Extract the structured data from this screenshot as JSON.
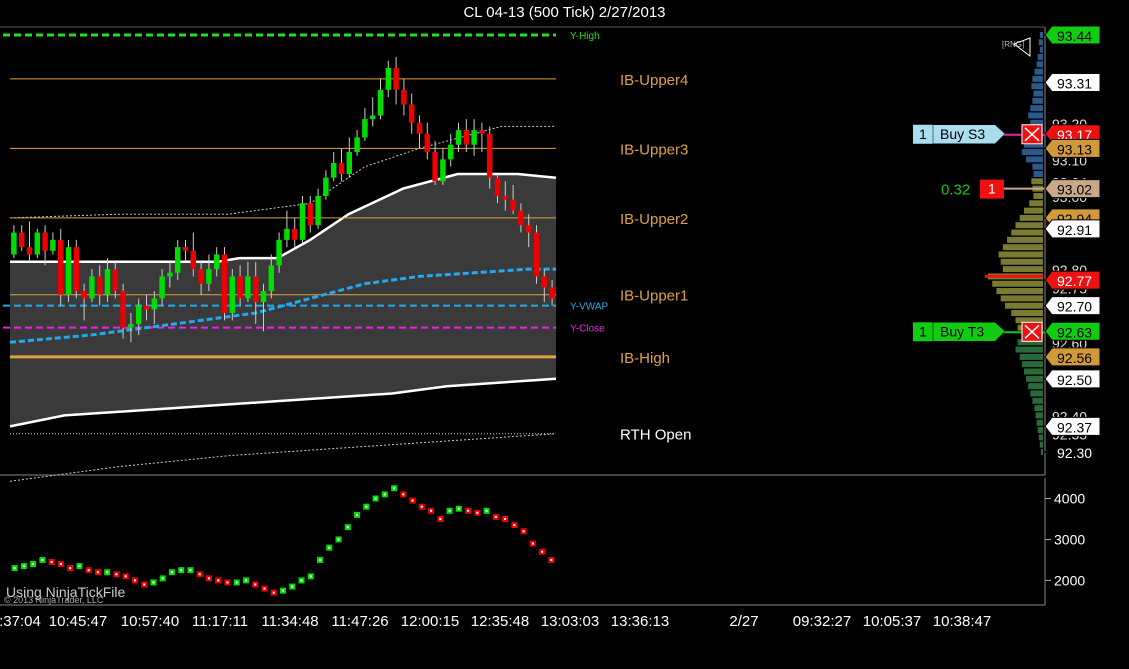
{
  "window": {
    "title": "CL 04-13 (500 Tick)  2/27/2013"
  },
  "colors": {
    "up": "#00dd00",
    "down": "#ee0000",
    "vwap": "#22aaee",
    "y_high": "#22dd22",
    "y_close": "#ee22ee",
    "ib": "#e0a040",
    "band_fill": "#3a3a3a",
    "volume_bar": "#3a7a2a"
  },
  "chart_data": [
    {
      "type": "candlestick",
      "title": "CL 04-13 (500 Tick)  2/27/2013",
      "ylim": [
        92.22,
        93.47
      ],
      "grid": false,
      "price_axis_labels": [
        "93.44",
        "93.31",
        "93.17",
        "93.13",
        "93.02",
        "92.94",
        "92.91",
        "92.77",
        "92.70",
        "92.63",
        "92.56",
        "92.50",
        "92.37",
        "92.30"
      ],
      "faint_axis_labels": [
        "93.20",
        "93.10",
        "93.04",
        "93.00",
        "92.80",
        "92.75",
        "92.60",
        "92.40",
        "92.35"
      ],
      "reference_lines": [
        {
          "name": "Y-High",
          "value": 93.44,
          "style": "dashed",
          "color": "#22dd22"
        },
        {
          "name": "Y-VWAP",
          "value": 92.7,
          "style": "dashed",
          "color": "#22aaee"
        },
        {
          "name": "Y-Close",
          "value": 92.64,
          "style": "dashed",
          "color": "#ee22ee"
        },
        {
          "name": "IB-Upper4",
          "value": 93.32,
          "style": "solid",
          "color": "#e0a040"
        },
        {
          "name": "IB-Upper3",
          "value": 93.13,
          "style": "solid",
          "color": "#e0a040"
        },
        {
          "name": "IB-Upper2",
          "value": 92.94,
          "style": "solid",
          "color": "#e0a040"
        },
        {
          "name": "IB-Upper1",
          "value": 92.73,
          "style": "solid",
          "color": "#e0a040"
        },
        {
          "name": "IB-High",
          "value": 92.56,
          "style": "solid-thick",
          "color": "#e0a040"
        },
        {
          "name": "RTH Open",
          "value": 92.35,
          "style": "dotted",
          "color": "#cccccc"
        }
      ],
      "side_labels": [
        "IB-Upper4",
        "IB-Upper3",
        "IB-Upper2",
        "IB-Upper1",
        "IB-High",
        "RTH Open"
      ],
      "candles": [
        [
          92.84,
          92.9,
          92.83,
          92.92
        ],
        [
          92.9,
          92.86,
          92.85,
          92.92
        ],
        [
          92.86,
          92.84,
          92.82,
          92.93
        ],
        [
          92.84,
          92.9,
          92.83,
          92.91
        ],
        [
          92.9,
          92.85,
          92.81,
          92.92
        ],
        [
          92.85,
          92.88,
          92.84,
          92.9
        ],
        [
          92.88,
          92.73,
          92.7,
          92.91
        ],
        [
          92.73,
          92.86,
          92.71,
          92.88
        ],
        [
          92.86,
          92.74,
          92.72,
          92.88
        ],
        [
          92.74,
          92.72,
          92.66,
          92.76
        ],
        [
          92.72,
          92.78,
          92.71,
          92.8
        ],
        [
          92.78,
          92.73,
          92.7,
          92.81
        ],
        [
          92.73,
          92.8,
          92.71,
          92.83
        ],
        [
          92.8,
          92.74,
          92.72,
          92.82
        ],
        [
          92.74,
          92.64,
          92.61,
          92.76
        ],
        [
          92.64,
          92.65,
          92.6,
          92.68
        ],
        [
          92.65,
          92.7,
          92.62,
          92.72
        ],
        [
          92.7,
          92.69,
          92.66,
          92.73
        ],
        [
          92.69,
          92.72,
          92.65,
          92.74
        ],
        [
          92.72,
          92.78,
          92.7,
          92.8
        ],
        [
          92.78,
          92.79,
          92.75,
          92.82
        ],
        [
          92.79,
          92.86,
          92.77,
          92.88
        ],
        [
          92.86,
          92.85,
          92.82,
          92.88
        ],
        [
          92.85,
          92.8,
          92.78,
          92.9
        ],
        [
          92.8,
          92.76,
          92.73,
          92.82
        ],
        [
          92.76,
          92.8,
          92.74,
          92.84
        ],
        [
          92.8,
          92.84,
          92.78,
          92.86
        ],
        [
          92.84,
          92.68,
          92.66,
          92.86
        ],
        [
          92.68,
          92.78,
          92.66,
          92.8
        ],
        [
          92.78,
          92.72,
          92.7,
          92.81
        ],
        [
          92.72,
          92.78,
          92.71,
          92.82
        ],
        [
          92.78,
          92.71,
          92.65,
          92.82
        ],
        [
          92.71,
          92.74,
          92.63,
          92.76
        ],
        [
          92.74,
          92.81,
          92.72,
          92.84
        ],
        [
          92.81,
          92.88,
          92.79,
          92.9
        ],
        [
          92.88,
          92.91,
          92.86,
          92.96
        ],
        [
          92.91,
          92.88,
          92.86,
          92.94
        ],
        [
          92.88,
          92.98,
          92.87,
          93.0
        ],
        [
          92.98,
          92.92,
          92.9,
          93.0
        ],
        [
          92.92,
          93.0,
          92.91,
          93.02
        ],
        [
          93.0,
          93.05,
          92.99,
          93.07
        ],
        [
          93.05,
          93.09,
          93.04,
          93.12
        ],
        [
          93.09,
          93.06,
          93.04,
          93.13
        ],
        [
          93.06,
          93.12,
          93.05,
          93.16
        ],
        [
          93.12,
          93.16,
          93.11,
          93.18
        ],
        [
          93.16,
          93.21,
          93.15,
          93.24
        ],
        [
          93.21,
          93.22,
          93.19,
          93.27
        ],
        [
          93.22,
          93.29,
          93.21,
          93.32
        ],
        [
          93.29,
          93.35,
          93.27,
          93.37
        ],
        [
          93.35,
          93.29,
          93.25,
          93.38
        ],
        [
          93.29,
          93.25,
          93.22,
          93.32
        ],
        [
          93.25,
          93.2,
          93.17,
          93.28
        ],
        [
          93.2,
          93.17,
          93.13,
          93.22
        ],
        [
          93.17,
          93.12,
          93.1,
          93.2
        ],
        [
          93.12,
          93.04,
          93.03,
          93.15
        ],
        [
          93.04,
          93.1,
          93.03,
          93.13
        ],
        [
          93.1,
          93.14,
          93.08,
          93.17
        ],
        [
          93.14,
          93.18,
          93.12,
          93.2
        ],
        [
          93.18,
          93.14,
          93.12,
          93.21
        ],
        [
          93.14,
          93.18,
          93.11,
          93.21
        ],
        [
          93.18,
          93.17,
          93.12,
          93.2
        ],
        [
          93.17,
          93.05,
          93.02,
          93.19
        ],
        [
          93.05,
          93.0,
          92.98,
          93.06
        ],
        [
          93.0,
          92.99,
          92.96,
          93.04
        ],
        [
          92.99,
          92.96,
          92.95,
          93.03
        ],
        [
          92.96,
          92.92,
          92.9,
          92.98
        ],
        [
          92.92,
          92.9,
          92.86,
          92.95
        ],
        [
          92.9,
          92.78,
          92.76,
          92.92
        ],
        [
          92.78,
          92.75,
          92.71,
          92.8
        ],
        [
          92.75,
          92.72,
          92.7,
          92.77
        ]
      ],
      "band_upper": [
        [
          0,
          92.82
        ],
        [
          0.38,
          92.82
        ],
        [
          0.42,
          92.83
        ],
        [
          0.49,
          92.83
        ],
        [
          0.55,
          92.88
        ],
        [
          0.62,
          92.95
        ],
        [
          0.72,
          93.02
        ],
        [
          0.82,
          93.06
        ],
        [
          0.88,
          93.06
        ],
        [
          0.93,
          93.06
        ],
        [
          1.0,
          93.05
        ]
      ],
      "band_lower": [
        [
          0,
          92.37
        ],
        [
          0.1,
          92.4
        ],
        [
          0.2,
          92.41
        ],
        [
          0.3,
          92.42
        ],
        [
          0.4,
          92.43
        ],
        [
          0.5,
          92.44
        ],
        [
          0.6,
          92.45
        ],
        [
          0.7,
          92.46
        ],
        [
          0.8,
          92.48
        ],
        [
          0.9,
          92.49
        ],
        [
          1.0,
          92.5
        ]
      ],
      "vwap_curve": [
        [
          0,
          92.6
        ],
        [
          0.15,
          92.62
        ],
        [
          0.3,
          92.65
        ],
        [
          0.45,
          92.68
        ],
        [
          0.55,
          92.72
        ],
        [
          0.65,
          92.76
        ],
        [
          0.75,
          92.78
        ],
        [
          0.85,
          92.79
        ],
        [
          0.95,
          92.8
        ],
        [
          1.0,
          92.8
        ]
      ],
      "outer_upper": [
        [
          0,
          92.94
        ],
        [
          0.2,
          92.95
        ],
        [
          0.4,
          92.95
        ],
        [
          0.55,
          92.98
        ],
        [
          0.65,
          93.08
        ],
        [
          0.75,
          93.13
        ],
        [
          0.9,
          93.19
        ],
        [
          1.0,
          93.19
        ]
      ],
      "outer_lower": [
        [
          0,
          92.22
        ],
        [
          0.2,
          92.26
        ],
        [
          0.4,
          92.29
        ],
        [
          0.6,
          92.31
        ],
        [
          0.8,
          92.33
        ],
        [
          1.0,
          92.35
        ]
      ],
      "volume_profile": [
        [
          93.44,
          3
        ],
        [
          93.42,
          4
        ],
        [
          93.4,
          3
        ],
        [
          93.38,
          5
        ],
        [
          93.36,
          6
        ],
        [
          93.34,
          8
        ],
        [
          93.32,
          10
        ],
        [
          93.3,
          11
        ],
        [
          93.28,
          9
        ],
        [
          93.26,
          10
        ],
        [
          93.24,
          12
        ],
        [
          93.22,
          14
        ],
        [
          93.2,
          12
        ],
        [
          93.18,
          11
        ],
        [
          93.16,
          14
        ],
        [
          93.14,
          18
        ],
        [
          93.12,
          20
        ],
        [
          93.1,
          16
        ],
        [
          93.08,
          10
        ],
        [
          93.06,
          9
        ],
        [
          93.04,
          11
        ],
        [
          93.02,
          10
        ],
        [
          93.0,
          9
        ],
        [
          92.98,
          13
        ],
        [
          92.96,
          18
        ],
        [
          92.94,
          22
        ],
        [
          92.92,
          26
        ],
        [
          92.9,
          30
        ],
        [
          92.88,
          34
        ],
        [
          92.86,
          38
        ],
        [
          92.84,
          42
        ],
        [
          92.82,
          40
        ],
        [
          92.8,
          38
        ],
        [
          92.78,
          52
        ],
        [
          92.76,
          48
        ],
        [
          92.74,
          44
        ],
        [
          92.72,
          40
        ],
        [
          92.7,
          36
        ],
        [
          92.68,
          30
        ],
        [
          92.66,
          26
        ],
        [
          92.64,
          24
        ],
        [
          92.62,
          20
        ],
        [
          92.6,
          24
        ],
        [
          92.58,
          26
        ],
        [
          92.56,
          22
        ],
        [
          92.54,
          20
        ],
        [
          92.52,
          18
        ],
        [
          92.5,
          16
        ],
        [
          92.48,
          14
        ],
        [
          92.46,
          12
        ],
        [
          92.44,
          10
        ],
        [
          92.42,
          8
        ],
        [
          92.4,
          7
        ],
        [
          92.38,
          6
        ],
        [
          92.36,
          5
        ],
        [
          92.34,
          4
        ],
        [
          92.32,
          3
        ],
        [
          92.3,
          2
        ]
      ],
      "orders": [
        {
          "qty": "1",
          "label": "Buy S3",
          "price": 93.17,
          "color": "#aaddee"
        },
        {
          "qty": "1",
          "label": "Buy T3",
          "price": 92.63,
          "color": "#11cc11"
        }
      ],
      "position": {
        "pnl": "0.32",
        "qty": "1",
        "price": 93.02
      },
      "price_tags": [
        {
          "price": 93.44,
          "text": "93.44",
          "bg": "#11cc11",
          "fg": "#000"
        },
        {
          "price": 93.31,
          "text": "93.31",
          "bg": "#fff",
          "fg": "#000"
        },
        {
          "price": 93.17,
          "text": "93.17",
          "bg": "#ee1111",
          "fg": "#fff"
        },
        {
          "price": 93.13,
          "text": "93.13",
          "bg": "#d09a3a",
          "fg": "#000"
        },
        {
          "price": 93.02,
          "text": "93.02",
          "bg": "#c8a888",
          "fg": "#000"
        },
        {
          "price": 92.94,
          "text": "92.94",
          "bg": "#d09a3a",
          "fg": "#000"
        },
        {
          "price": 92.91,
          "text": "92.91",
          "bg": "#fff",
          "fg": "#000"
        },
        {
          "price": 92.77,
          "text": "92.77",
          "bg": "#ee1111",
          "fg": "#fff"
        },
        {
          "price": 92.7,
          "text": "92.70",
          "bg": "#fff",
          "fg": "#000"
        },
        {
          "price": 92.63,
          "text": "92.63",
          "bg": "#11cc11",
          "fg": "#000"
        },
        {
          "price": 92.56,
          "text": "92.56",
          "bg": "#d09a3a",
          "fg": "#000"
        },
        {
          "price": 92.5,
          "text": "92.50",
          "bg": "#fff",
          "fg": "#000"
        },
        {
          "price": 92.37,
          "text": "92.37",
          "bg": "#fff",
          "fg": "#000"
        },
        {
          "price": 92.3,
          "text": "92.30",
          "bg": "#000",
          "fg": "#fff"
        }
      ]
    },
    {
      "type": "line",
      "title": "",
      "ylim": [
        1400,
        4500
      ],
      "y_ticks": [
        2000,
        3000,
        4000
      ],
      "y_tick_labels": [
        "2000",
        "3000",
        "4000"
      ],
      "values": [
        2300,
        2350,
        2400,
        2500,
        2450,
        2400,
        2300,
        2350,
        2250,
        2200,
        2200,
        2150,
        2100,
        2000,
        1900,
        1950,
        2050,
        2200,
        2250,
        2250,
        2150,
        2050,
        2000,
        1950,
        1950,
        2000,
        1900,
        1800,
        1700,
        1750,
        1850,
        2000,
        2100,
        2500,
        2800,
        3000,
        3300,
        3600,
        3800,
        4000,
        4100,
        4250,
        4100,
        3950,
        3800,
        3700,
        3500,
        3700,
        3750,
        3700,
        3650,
        3700,
        3550,
        3500,
        3350,
        3200,
        2900,
        2700,
        2500
      ]
    }
  ],
  "x_axis": {
    "labels": [
      ":37:04",
      "10:45:47",
      "10:57:40",
      "11:17:11",
      "11:34:48",
      "11:47:26",
      "12:00:15",
      "12:35:48",
      "13:03:03",
      "13:36:13",
      "2/27",
      "09:32:27",
      "10:05:37",
      "10:38:47"
    ]
  },
  "footer": {
    "caption": "Using NinjaTickFile",
    "copyright": "© 2013 NinjaTrader, LLC"
  },
  "badges": {
    "top_right": "[RNG]"
  }
}
